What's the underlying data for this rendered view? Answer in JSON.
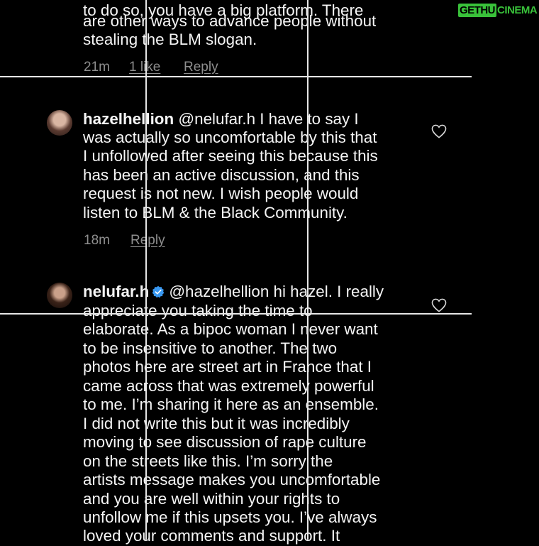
{
  "watermark": {
    "left": "GETHU",
    "right": "CINEMA"
  },
  "comments": [
    {
      "lines": [
        "to do so, you have a big platform. There",
        "are other ways to advance people without",
        "stealing the BLM slogan."
      ],
      "time": "21m",
      "likes": "1 like",
      "reply": "Reply"
    },
    {
      "username": "hazelhellion",
      "first_line_rest": "@nelufar.h I have to say I",
      "lines": [
        "was actually so uncomfortable by this that",
        "I unfollowed after seeing this because this",
        "has been an active discussion, and this",
        "request is not new. I wish people would",
        "listen to BLM & the Black Community."
      ],
      "time": "18m",
      "reply": "Reply",
      "like_icon": "heart-outline-icon"
    },
    {
      "username": "nelufar.h",
      "verified": true,
      "first_line_rest": "@hazelhellion hi hazel. I really",
      "lines": [
        "appreciate you taking the time to",
        "elaborate. As a bipoc woman I never want",
        "to be insensitive to another. The two",
        "photos here are street art in France that I",
        "came across that was extremely powerful",
        "to me. I’m sharing it here as an ensemble.",
        "I did not write this but it was incredibly",
        "moving to see discussion of rape culture",
        "on the streets like this. I’m sorry the",
        "artists message makes you uncomfortable",
        "and you are well within your rights to",
        "unfollow me if this upsets you. I’ve always",
        "loved your comments and support. It"
      ],
      "like_icon": "heart-outline-icon"
    }
  ],
  "colors": {
    "background": "#000000",
    "text": "#f5f5f5",
    "meta": "#8e8e8e",
    "verified": "#3897f0",
    "overlay_lines": "#e6e6e6"
  }
}
